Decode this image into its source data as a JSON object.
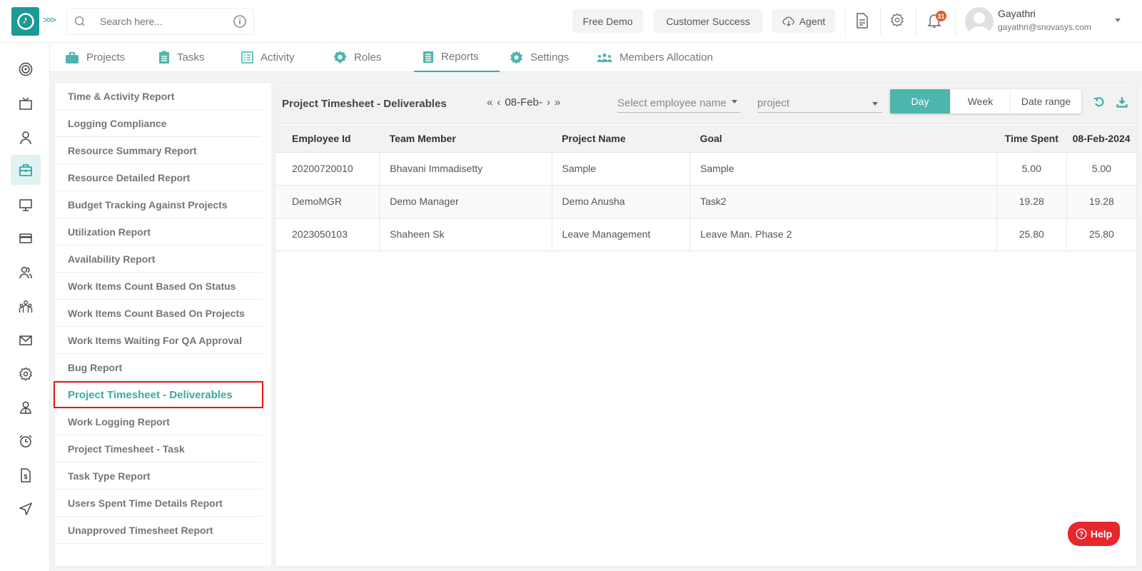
{
  "header": {
    "search_placeholder": "Search here...",
    "buttons": {
      "free_demo": "Free Demo",
      "customer_success": "Customer Success",
      "agent": "Agent"
    },
    "notifications_count": "31",
    "user": {
      "name": "Gayathri",
      "email": "gayathri@snovasys.com"
    }
  },
  "rail": {
    "items": [
      {
        "icon": "target-icon"
      },
      {
        "icon": "tv-icon"
      },
      {
        "icon": "user-icon"
      },
      {
        "icon": "briefcase-icon",
        "active": true
      },
      {
        "icon": "monitor-icon"
      },
      {
        "icon": "credit-card-icon"
      },
      {
        "icon": "users-icon"
      },
      {
        "icon": "team-icon"
      },
      {
        "icon": "mail-icon"
      },
      {
        "icon": "gear-icon"
      },
      {
        "icon": "employee-icon"
      },
      {
        "icon": "alarm-clock-icon"
      },
      {
        "icon": "invoice-icon"
      },
      {
        "icon": "send-icon"
      }
    ]
  },
  "nav": {
    "tabs": [
      {
        "label": "Projects",
        "icon": "briefcase-icon"
      },
      {
        "label": "Tasks",
        "icon": "clipboard-icon"
      },
      {
        "label": "Activity",
        "icon": "list-icon"
      },
      {
        "label": "Roles",
        "icon": "roles-icon"
      },
      {
        "label": "Reports",
        "icon": "report-icon",
        "active": true
      },
      {
        "label": "Settings",
        "icon": "gear-icon"
      },
      {
        "label": "Members Allocation",
        "icon": "members-icon"
      }
    ]
  },
  "reports": {
    "items": [
      "Time & Activity Report",
      "Logging Compliance",
      "Resource Summary Report",
      "Resource Detailed Report",
      "Budget Tracking Against Projects",
      "Utilization Report",
      "Availability Report",
      "Work Items Count Based On Status",
      "Work Items Count Based On Projects",
      "Work Items Waiting For QA Approval",
      "Bug Report",
      "Project Timesheet - Deliverables",
      "Work Logging Report",
      "Project Timesheet - Task",
      "Task Type Report",
      "Users Spent Time Details Report",
      "Unapproved Timesheet Report"
    ],
    "active_index": 11
  },
  "main": {
    "title": "Project Timesheet - Deliverables",
    "date": "08-Feb-",
    "employee_select_placeholder": "Select employee name",
    "project_select_placeholder": "project",
    "range_buttons": {
      "day": "Day",
      "week": "Week",
      "date_range": "Date range"
    },
    "active_range": "Day",
    "table": {
      "columns": [
        "Employee Id",
        "Team Member",
        "Project Name",
        "Goal",
        "Time Spent",
        "08-Feb-2024"
      ],
      "rows": [
        [
          "20200720010",
          "Bhavani Immadisetty",
          "Sample",
          "Sample",
          "5.00",
          "5.00"
        ],
        [
          "DemoMGR",
          "Demo Manager",
          "Demo Anusha",
          "Task2",
          "19.28",
          "19.28"
        ],
        [
          "2023050103",
          "Shaheen Sk",
          "Leave Management",
          "Leave Man. Phase 2",
          "25.80",
          "25.80"
        ]
      ]
    }
  },
  "help_label": "Help",
  "colors": {
    "accent": "#3aa9a3",
    "logo": "#1a9b95",
    "help": "#e8262e",
    "highlight_border": "#e8111a",
    "badge": "#e4572e"
  }
}
